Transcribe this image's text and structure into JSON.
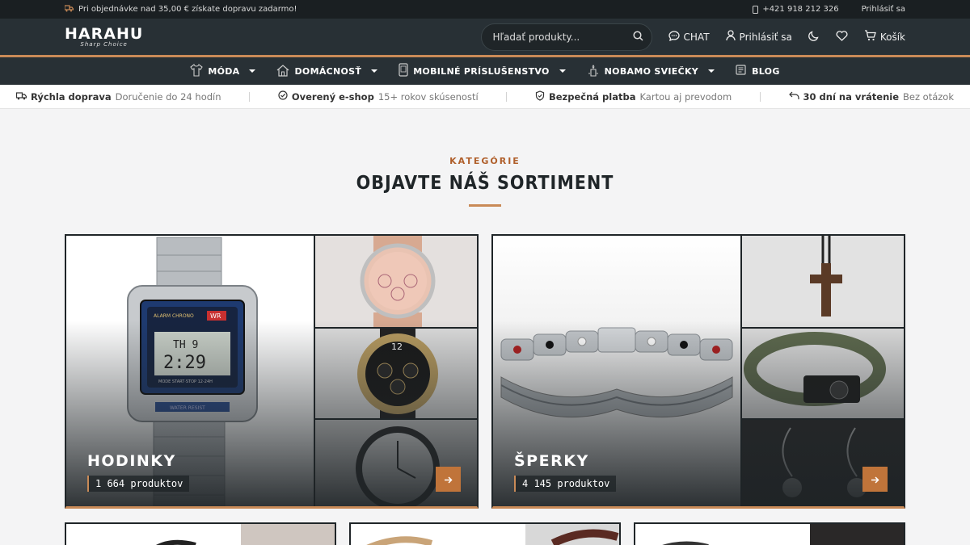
{
  "topbar": {
    "promo": "Pri objednávke nad 35,00 € získate dopravu zadarmo!",
    "phone": "+421 918 212 326",
    "login": "Prihlásiť sa"
  },
  "header": {
    "logo_main": "HARAHU",
    "logo_sub": "Sharp Choice",
    "search_placeholder": "Hľadať produkty...",
    "chat": "CHAT",
    "login": "Prihlásiť sa",
    "cart": "Košík"
  },
  "nav": {
    "items": [
      {
        "label": "MÓDA"
      },
      {
        "label": "DOMÁCNOSŤ"
      },
      {
        "label": "MOBILNÉ PRÍSLUŠENSTVO"
      },
      {
        "label": "NOBAMO SVIEČKY"
      },
      {
        "label": "BLOG"
      }
    ]
  },
  "trust": [
    {
      "title": "Rýchla doprava",
      "sub": "Doručenie do 24 hodín"
    },
    {
      "title": "Overený e-shop",
      "sub": "15+ rokov skúseností"
    },
    {
      "title": "Bezpečná platba",
      "sub": "Kartou aj prevodom"
    },
    {
      "title": "30 dní na vrátenie",
      "sub": "Bez otázok"
    }
  ],
  "section": {
    "label": "KATEGÓRIE",
    "title": "OBJAVTE NÁŠ SORTIMENT"
  },
  "categories": [
    {
      "title": "HODINKY",
      "count": "1 664 produktov"
    },
    {
      "title": "ŠPERKY",
      "count": "4 145 produktov"
    }
  ],
  "colors": {
    "accent": "#c98a57",
    "dark": "#283035",
    "button": "#c0743a"
  }
}
